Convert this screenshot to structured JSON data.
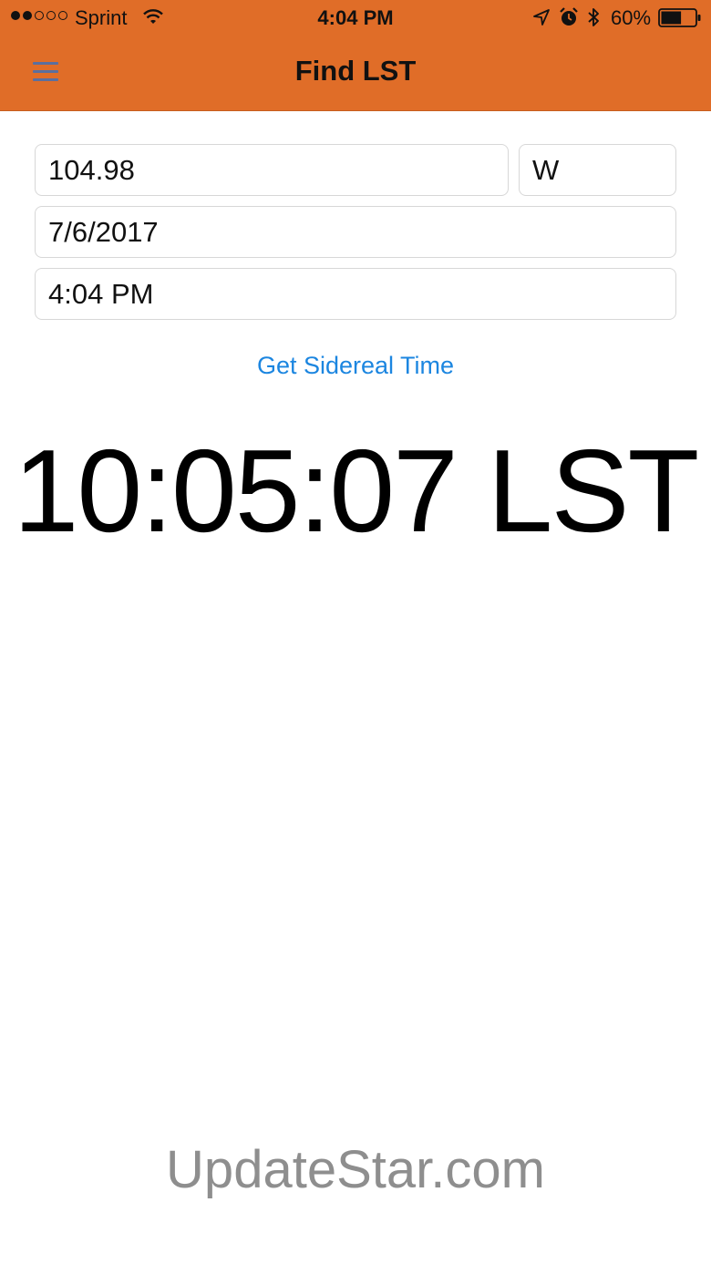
{
  "status_bar": {
    "carrier": "Sprint",
    "time": "4:04 PM",
    "battery_percent": "60%",
    "signal_bars_filled": 2,
    "signal_bars_total": 5,
    "battery_level": 0.6
  },
  "nav": {
    "title": "Find LST",
    "menu_icon": "hamburger-menu-icon"
  },
  "form": {
    "longitude": "104.98",
    "direction": "W",
    "date": "7/6/2017",
    "time": "4:04 PM"
  },
  "button": {
    "label": "Get Sidereal Time"
  },
  "result": {
    "text": "10:05:07 LST"
  },
  "watermark": "UpdateStar.com",
  "colors": {
    "header": "#e06d28",
    "link": "#1c86e0",
    "menu_icon": "#5b6f9e",
    "watermark": "#8e8e8e"
  }
}
